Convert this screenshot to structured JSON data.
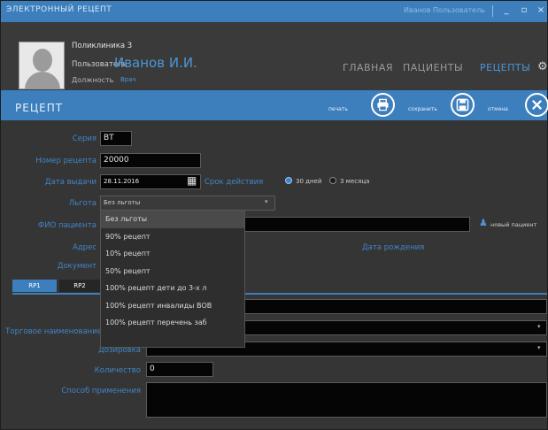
{
  "window": {
    "title": "ЭЛЕКТРОННЫЙ РЕЦЕПТ",
    "user_link": "Иванов Пользователь",
    "buttons": [
      "_",
      "▫",
      "×"
    ]
  },
  "header": {
    "org": "Поликлиника 3",
    "user_label": "Пользователь",
    "user_name": "Иванов И.И.",
    "role_label": "Должность",
    "role_value": "Врач",
    "nav": {
      "main": "ГЛАВНАЯ",
      "patients": "ПАЦИЕНТЫ",
      "recipes": "РЕЦЕПТЫ"
    }
  },
  "section": {
    "title": "РЕЦЕПТ",
    "print_label": "печать",
    "save_label": "сохранить",
    "cancel_label": "отмена"
  },
  "form": {
    "series_label": "Серия",
    "series_value": "ВТ",
    "number_label": "Номер рецепта",
    "number_value": "20000",
    "date_label": "Дата выдачи",
    "date_value": "28.11.2016",
    "validity_label": "Срок действия",
    "validity_30": "30 дней",
    "validity_3m": "3 месяца",
    "benefit_label": "Льгота",
    "benefit_value": "Без льготы",
    "fio_label": "ФИО пациента",
    "new_patient": "новый пациент",
    "address_label": "Адрес",
    "birth_date_label": "Дата рождения",
    "document_label": "Документ",
    "tabs": [
      "RP1",
      "RP2"
    ],
    "trade_name_label": "Торговое наименование",
    "dosage_label": "Дозировка",
    "quantity_label": "Количество",
    "quantity_value": "0",
    "usage_label": "Способ применения"
  },
  "dropdown": {
    "options": [
      "Без льготы",
      "90% рецепт",
      "10% рецепт",
      "50% рецепт",
      "100% рецепт дети до 3-х л",
      "100% рецепт инвалиды ВОВ",
      "100% рецепт перечень заб"
    ]
  },
  "colors": {
    "accent": "#3d7fbd",
    "label": "#3f86c9",
    "field_bg": "#050505"
  }
}
